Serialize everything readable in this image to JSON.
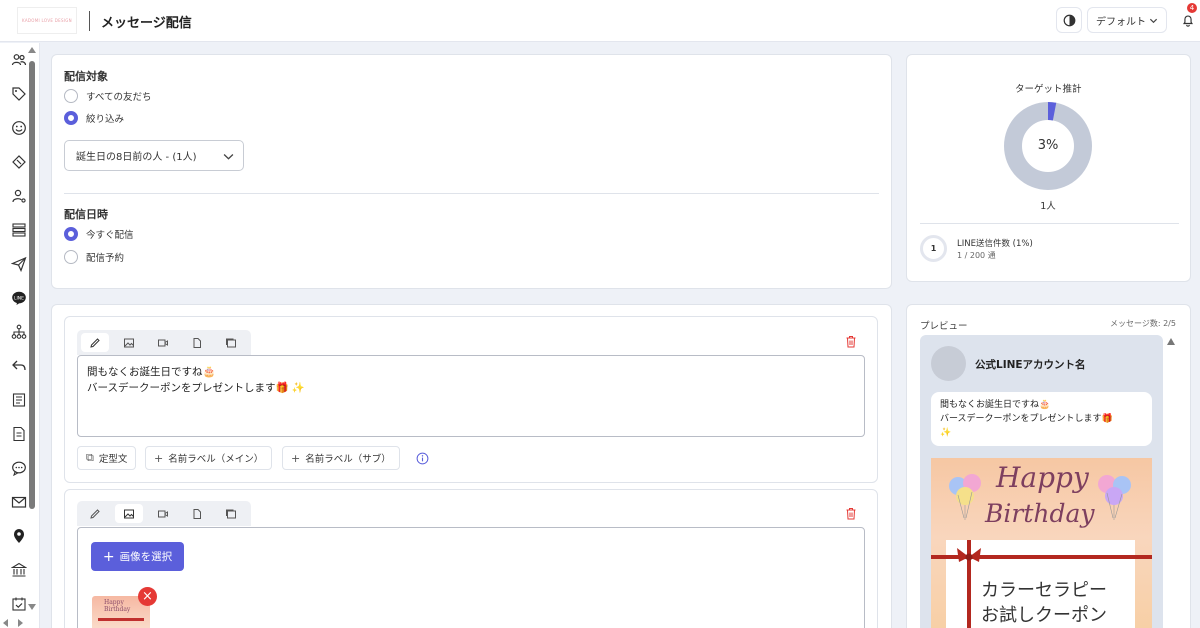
{
  "header": {
    "logo_text": "KADOMI LOVE DESIGN",
    "title": "メッセージ配信",
    "display_mode_select": "デフォルト",
    "notification_count": "4"
  },
  "sidebar": {
    "items": [
      {
        "icon": "users-icon"
      },
      {
        "icon": "tag-icon"
      },
      {
        "icon": "smile-icon"
      },
      {
        "icon": "ticket-icon"
      },
      {
        "icon": "user-settings-icon"
      },
      {
        "icon": "list-icon"
      },
      {
        "icon": "send-icon"
      },
      {
        "icon": "line-icon"
      },
      {
        "icon": "flow-icon"
      },
      {
        "icon": "reply-icon"
      },
      {
        "icon": "document-list-icon"
      },
      {
        "icon": "form-icon"
      },
      {
        "icon": "chat-icon"
      },
      {
        "icon": "mail-icon"
      },
      {
        "icon": "location-icon"
      },
      {
        "icon": "bank-icon"
      },
      {
        "icon": "calendar-check-icon"
      }
    ]
  },
  "target": {
    "label": "配信対象",
    "options": [
      "すべての友だち",
      "絞り込み"
    ],
    "selected": "絞り込み",
    "filter_value": "誕生日の8日前の人 - (1人)"
  },
  "schedule": {
    "label": "配信日時",
    "options": [
      "今すぐ配信",
      "配信予約"
    ],
    "selected": "今すぐ配信"
  },
  "estimate": {
    "title": "ターゲット推計",
    "percent": "3%",
    "percent_value": 3,
    "count": "1人",
    "line_ring": "1",
    "line_label": "LINE送信件数 (1%)",
    "line_sub": "1 / 200 通",
    "accent": "#5b5fdb",
    "ring_color": "#c3cad8"
  },
  "message1": {
    "line1": "間もなくお誕生日ですね🎂",
    "line2": "バースデークーポンをプレゼントします🎁 ✨",
    "chips": [
      "定型文",
      "名前ラベル（メイン）",
      "名前ラベル（サブ）"
    ]
  },
  "message2": {
    "select_image_button": "画像を選択",
    "thumb_text": "Happy Birthday"
  },
  "preview": {
    "label": "プレビュー",
    "message_count": "メッセージ数: 2/5",
    "account_name": "公式LINEアカウント名",
    "bubble_line1": "間もなくお誕生日ですね🎂",
    "bubble_line2": "バースデークーポンをプレゼントします🎁",
    "bubble_line3": "✨",
    "image_text1": "Happy",
    "image_text2": "Birthday",
    "coupon_line1": "カラーセラピー",
    "coupon_line2": "お試しクーポン"
  }
}
